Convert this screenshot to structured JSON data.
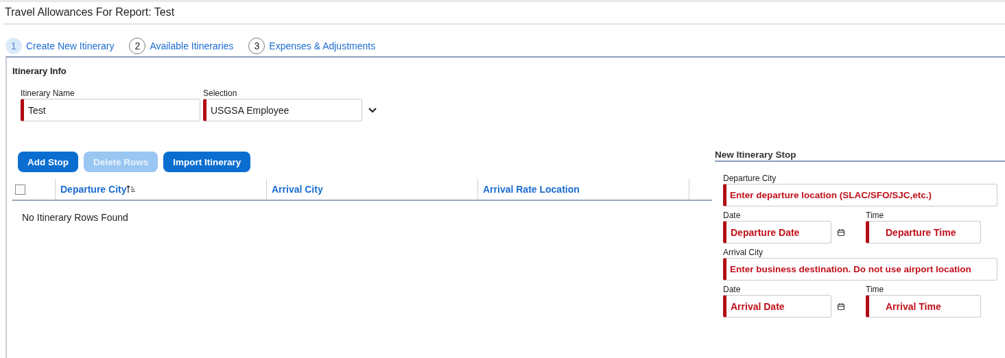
{
  "window": {
    "title": "Travel Allowances For Report: Test"
  },
  "steps": [
    {
      "number": "1",
      "label": "Create New Itinerary",
      "selected": true
    },
    {
      "number": "2",
      "label": "Available Itineraries",
      "selected": false
    },
    {
      "number": "3",
      "label": "Expenses & Adjustments",
      "selected": false
    }
  ],
  "itinerary_info": {
    "heading": "Itinerary Info",
    "name_label": "Itinerary Name",
    "name_value": "Test",
    "selection_label": "Selection",
    "selection_value": "USGSA Employee"
  },
  "buttons": [
    {
      "label": "Add Stop",
      "disabled": false
    },
    {
      "label": "Delete Rows",
      "disabled": true
    },
    {
      "label": "Import Itinerary",
      "disabled": false
    }
  ],
  "table": {
    "select_all_checked": false,
    "columns": [
      {
        "label": "Departure City",
        "sorted": true
      },
      {
        "label": "Arrival City",
        "sorted": false
      },
      {
        "label": "Arrival Rate Location",
        "sorted": false
      }
    ],
    "empty_message": "No Itinerary Rows Found"
  },
  "new_stop": {
    "heading": "New Itinerary Stop",
    "departure_city": {
      "label": "Departure City",
      "value": "Enter departure location (SLAC/SFO/SJC,etc.)"
    },
    "departure_date": {
      "label": "Date",
      "value": "Departure Date"
    },
    "departure_time": {
      "label": "Time",
      "value": "Departure Time"
    },
    "arrival_city": {
      "label": "Arrival City",
      "value": "Enter business destination. Do not use airport location"
    },
    "arrival_date": {
      "label": "Date",
      "value": "Arrival Date"
    },
    "arrival_time": {
      "label": "Time",
      "value": "Arrival Time"
    }
  }
}
